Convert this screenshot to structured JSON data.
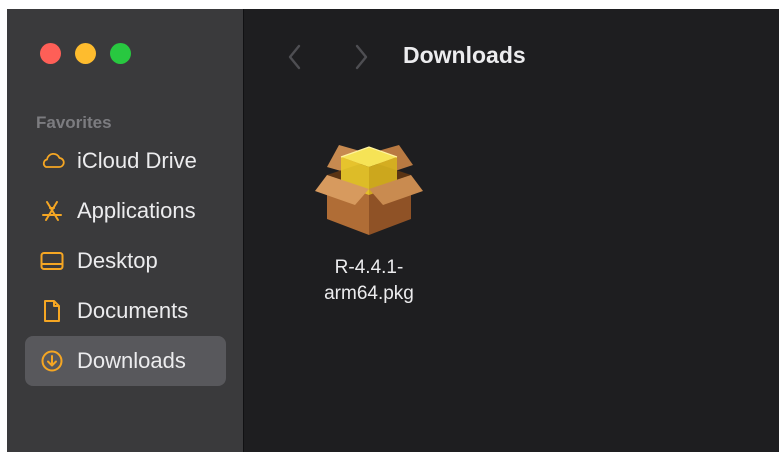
{
  "window": {
    "traffic_lights": [
      "close",
      "minimize",
      "zoom"
    ]
  },
  "sidebar": {
    "section_label": "Favorites",
    "accent_color": "#f5a623",
    "items": [
      {
        "label": "iCloud Drive",
        "icon": "cloud-icon",
        "selected": false
      },
      {
        "label": "Applications",
        "icon": "applications-icon",
        "selected": false
      },
      {
        "label": "Desktop",
        "icon": "desktop-icon",
        "selected": false
      },
      {
        "label": "Documents",
        "icon": "document-icon",
        "selected": false
      },
      {
        "label": "Downloads",
        "icon": "download-icon",
        "selected": true
      }
    ]
  },
  "toolbar": {
    "title": "Downloads",
    "back_icon": "chevron-left-icon",
    "forward_icon": "chevron-right-icon"
  },
  "files": [
    {
      "name": "R-4.4.1-arm64.pkg",
      "icon": "package-icon"
    }
  ]
}
